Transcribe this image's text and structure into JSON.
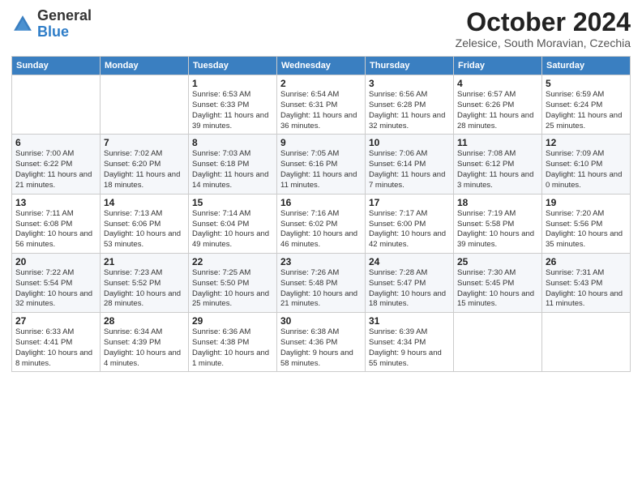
{
  "header": {
    "logo_general": "General",
    "logo_blue": "Blue",
    "month_title": "October 2024",
    "location": "Zelesice, South Moravian, Czechia"
  },
  "weekdays": [
    "Sunday",
    "Monday",
    "Tuesday",
    "Wednesday",
    "Thursday",
    "Friday",
    "Saturday"
  ],
  "weeks": [
    [
      {
        "day": "",
        "info": ""
      },
      {
        "day": "",
        "info": ""
      },
      {
        "day": "1",
        "info": "Sunrise: 6:53 AM\nSunset: 6:33 PM\nDaylight: 11 hours and 39 minutes."
      },
      {
        "day": "2",
        "info": "Sunrise: 6:54 AM\nSunset: 6:31 PM\nDaylight: 11 hours and 36 minutes."
      },
      {
        "day": "3",
        "info": "Sunrise: 6:56 AM\nSunset: 6:28 PM\nDaylight: 11 hours and 32 minutes."
      },
      {
        "day": "4",
        "info": "Sunrise: 6:57 AM\nSunset: 6:26 PM\nDaylight: 11 hours and 28 minutes."
      },
      {
        "day": "5",
        "info": "Sunrise: 6:59 AM\nSunset: 6:24 PM\nDaylight: 11 hours and 25 minutes."
      }
    ],
    [
      {
        "day": "6",
        "info": "Sunrise: 7:00 AM\nSunset: 6:22 PM\nDaylight: 11 hours and 21 minutes."
      },
      {
        "day": "7",
        "info": "Sunrise: 7:02 AM\nSunset: 6:20 PM\nDaylight: 11 hours and 18 minutes."
      },
      {
        "day": "8",
        "info": "Sunrise: 7:03 AM\nSunset: 6:18 PM\nDaylight: 11 hours and 14 minutes."
      },
      {
        "day": "9",
        "info": "Sunrise: 7:05 AM\nSunset: 6:16 PM\nDaylight: 11 hours and 11 minutes."
      },
      {
        "day": "10",
        "info": "Sunrise: 7:06 AM\nSunset: 6:14 PM\nDaylight: 11 hours and 7 minutes."
      },
      {
        "day": "11",
        "info": "Sunrise: 7:08 AM\nSunset: 6:12 PM\nDaylight: 11 hours and 3 minutes."
      },
      {
        "day": "12",
        "info": "Sunrise: 7:09 AM\nSunset: 6:10 PM\nDaylight: 11 hours and 0 minutes."
      }
    ],
    [
      {
        "day": "13",
        "info": "Sunrise: 7:11 AM\nSunset: 6:08 PM\nDaylight: 10 hours and 56 minutes."
      },
      {
        "day": "14",
        "info": "Sunrise: 7:13 AM\nSunset: 6:06 PM\nDaylight: 10 hours and 53 minutes."
      },
      {
        "day": "15",
        "info": "Sunrise: 7:14 AM\nSunset: 6:04 PM\nDaylight: 10 hours and 49 minutes."
      },
      {
        "day": "16",
        "info": "Sunrise: 7:16 AM\nSunset: 6:02 PM\nDaylight: 10 hours and 46 minutes."
      },
      {
        "day": "17",
        "info": "Sunrise: 7:17 AM\nSunset: 6:00 PM\nDaylight: 10 hours and 42 minutes."
      },
      {
        "day": "18",
        "info": "Sunrise: 7:19 AM\nSunset: 5:58 PM\nDaylight: 10 hours and 39 minutes."
      },
      {
        "day": "19",
        "info": "Sunrise: 7:20 AM\nSunset: 5:56 PM\nDaylight: 10 hours and 35 minutes."
      }
    ],
    [
      {
        "day": "20",
        "info": "Sunrise: 7:22 AM\nSunset: 5:54 PM\nDaylight: 10 hours and 32 minutes."
      },
      {
        "day": "21",
        "info": "Sunrise: 7:23 AM\nSunset: 5:52 PM\nDaylight: 10 hours and 28 minutes."
      },
      {
        "day": "22",
        "info": "Sunrise: 7:25 AM\nSunset: 5:50 PM\nDaylight: 10 hours and 25 minutes."
      },
      {
        "day": "23",
        "info": "Sunrise: 7:26 AM\nSunset: 5:48 PM\nDaylight: 10 hours and 21 minutes."
      },
      {
        "day": "24",
        "info": "Sunrise: 7:28 AM\nSunset: 5:47 PM\nDaylight: 10 hours and 18 minutes."
      },
      {
        "day": "25",
        "info": "Sunrise: 7:30 AM\nSunset: 5:45 PM\nDaylight: 10 hours and 15 minutes."
      },
      {
        "day": "26",
        "info": "Sunrise: 7:31 AM\nSunset: 5:43 PM\nDaylight: 10 hours and 11 minutes."
      }
    ],
    [
      {
        "day": "27",
        "info": "Sunrise: 6:33 AM\nSunset: 4:41 PM\nDaylight: 10 hours and 8 minutes."
      },
      {
        "day": "28",
        "info": "Sunrise: 6:34 AM\nSunset: 4:39 PM\nDaylight: 10 hours and 4 minutes."
      },
      {
        "day": "29",
        "info": "Sunrise: 6:36 AM\nSunset: 4:38 PM\nDaylight: 10 hours and 1 minute."
      },
      {
        "day": "30",
        "info": "Sunrise: 6:38 AM\nSunset: 4:36 PM\nDaylight: 9 hours and 58 minutes."
      },
      {
        "day": "31",
        "info": "Sunrise: 6:39 AM\nSunset: 4:34 PM\nDaylight: 9 hours and 55 minutes."
      },
      {
        "day": "",
        "info": ""
      },
      {
        "day": "",
        "info": ""
      }
    ]
  ]
}
